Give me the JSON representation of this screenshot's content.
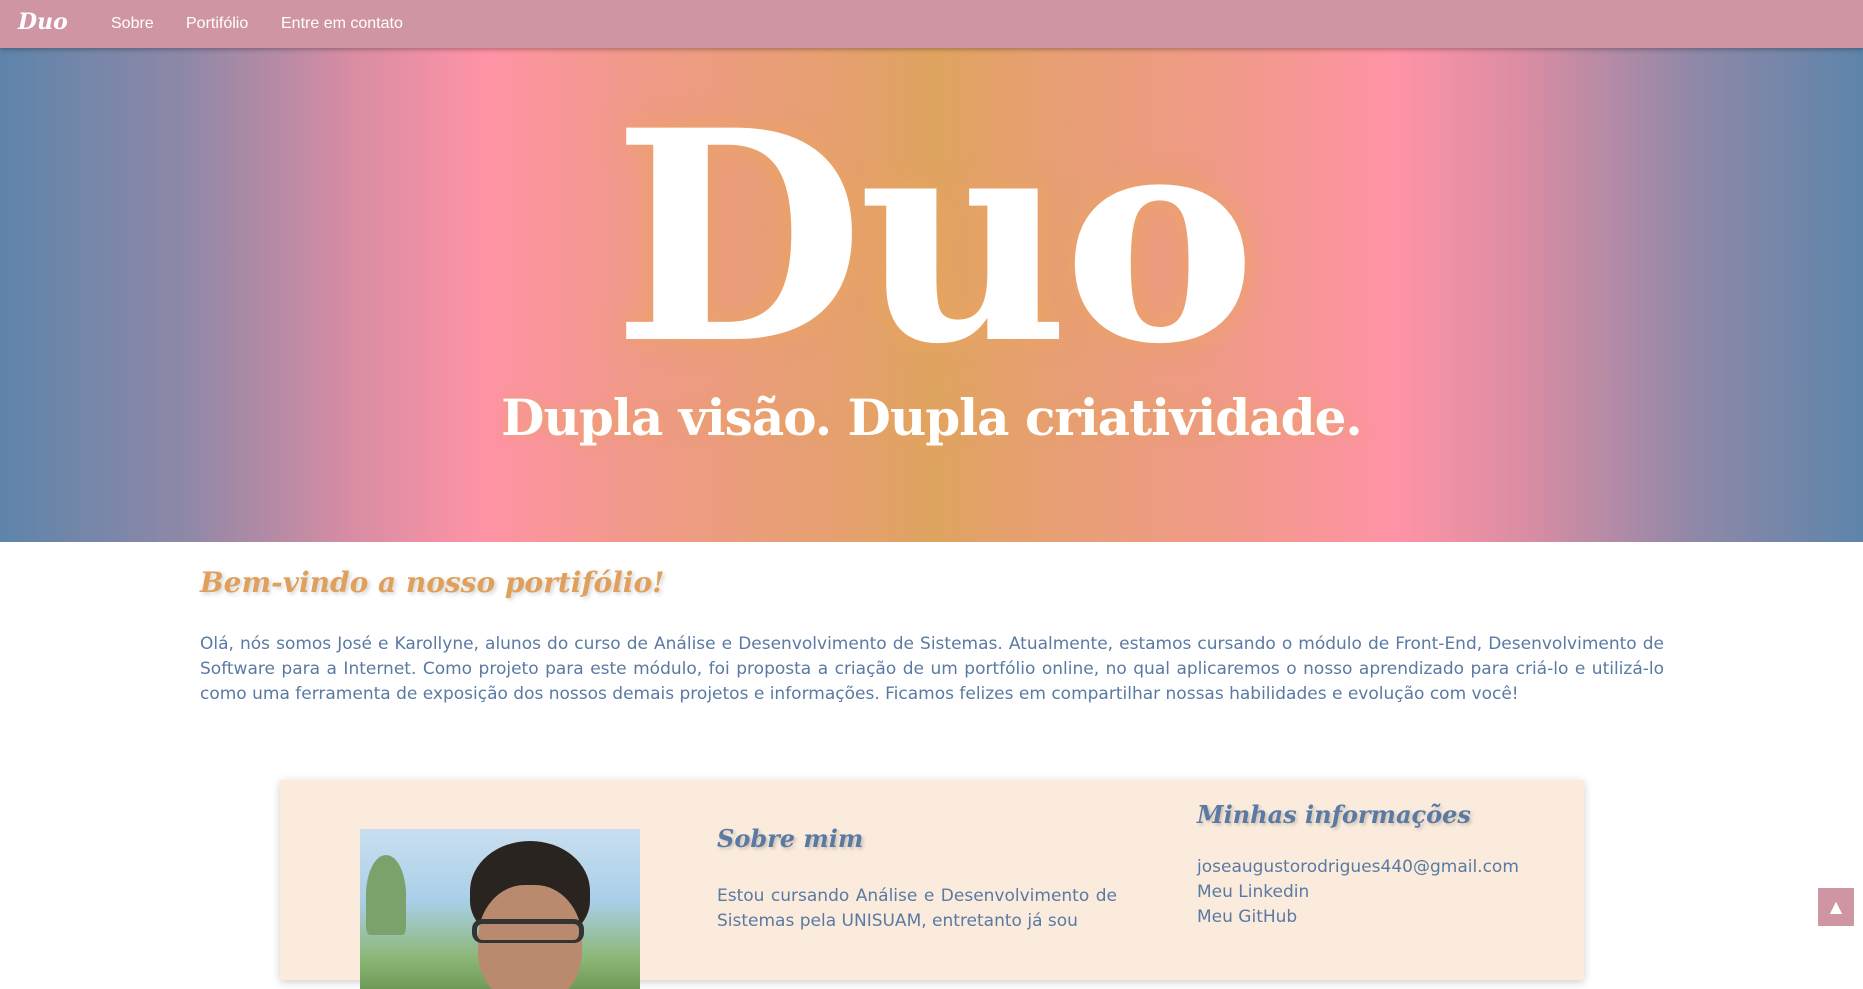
{
  "navbar": {
    "brand": "Duo",
    "links": [
      {
        "label": "Sobre"
      },
      {
        "label": "Portifólio"
      },
      {
        "label": "Entre em contato"
      }
    ]
  },
  "hero": {
    "title": "Duo",
    "subtitle": "Dupla visão. Dupla criatividade."
  },
  "welcome": {
    "title": "Bem-vindo a nosso portifólio!",
    "text": "Olá, nós somos José e Karollyne, alunos do curso de Análise e Desenvolvimento de Sistemas. Atualmente, estamos cursando o módulo de Front-End, Desenvolvimento de Software para a Internet. Como projeto para este módulo, foi proposta a criação de um portfólio online, no qual aplicaremos o nosso aprendizado para criá-lo e utilizá-lo como uma ferramenta de exposição dos nossos demais projetos e informações. Ficamos felizes em compartilhar nossas habilidades e evolução com você!"
  },
  "card": {
    "about_title": "Sobre mim",
    "about_text": "Estou cursando Análise e Desenvolvimento de Sistemas pela UNISUAM, entretanto já sou",
    "info_title": "Minhas informações",
    "info_items": [
      {
        "label": "joseaugustorodrigues440@gmail.com"
      },
      {
        "label": "Meu Linkedin"
      },
      {
        "label": "Meu GitHub"
      }
    ]
  },
  "back_to_top": {
    "label": "▲",
    "icon": "arrow-up-icon"
  },
  "colors": {
    "navbar": "#cf95a3",
    "accent_orange": "#e0a05c",
    "text_blue": "#5a7aa3",
    "card_bg": "#faebdc"
  }
}
